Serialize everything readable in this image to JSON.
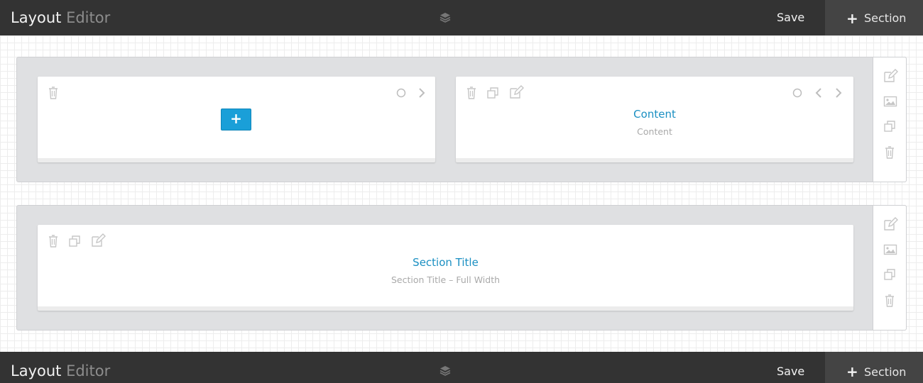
{
  "header": {
    "title_bold": "Layout",
    "title_light": "Editor",
    "save_label": "Save",
    "add_section_label": "Section",
    "add_section_symbol": "+",
    "layers_icon": "layers-icon"
  },
  "footer": {
    "title_bold": "Layout",
    "title_light": "Editor",
    "save_label": "Save",
    "add_section_label": "Section",
    "add_section_symbol": "+"
  },
  "sections": [
    {
      "modules": [
        {
          "type": "empty",
          "add_symbol": "+"
        },
        {
          "type": "content",
          "title": "Content",
          "subtitle": "Content"
        }
      ]
    },
    {
      "modules": [
        {
          "type": "section-title",
          "title": "Section Title",
          "subtitle": "Section Title – Full Width"
        }
      ]
    }
  ],
  "colors": {
    "bar": "#333333",
    "accent": "#1a9fd8",
    "module_title": "#1a8fc2",
    "section_bg": "#dfe0e2"
  },
  "icons": [
    "trash-icon",
    "duplicate-icon",
    "edit-icon",
    "circle-icon",
    "chevron-left-icon",
    "chevron-right-icon",
    "image-icon",
    "layers-icon"
  ]
}
